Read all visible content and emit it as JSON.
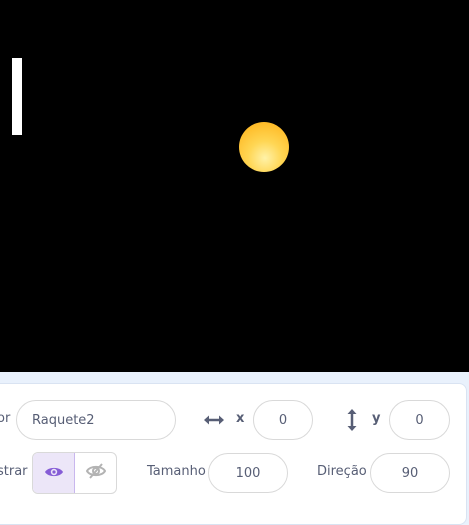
{
  "stage": {
    "paddle_color": "#ffffff",
    "ball_color": "#ffc336",
    "background": "#000000"
  },
  "sprite_info": {
    "sprite_label_partial": "or",
    "sprite_name": "Raquete2",
    "x_label": "x",
    "x_value": "0",
    "y_label": "y",
    "y_value": "0",
    "show_label_partial": "strar",
    "size_label": "Tamanho",
    "size_value": "100",
    "direction_label": "Direção",
    "direction_value": "90",
    "show_state": "visible",
    "icons": [
      "horizontal-arrows-icon",
      "vertical-arrows-icon",
      "eye-icon",
      "eye-slash-icon"
    ],
    "accent_color": "#855cd6"
  }
}
